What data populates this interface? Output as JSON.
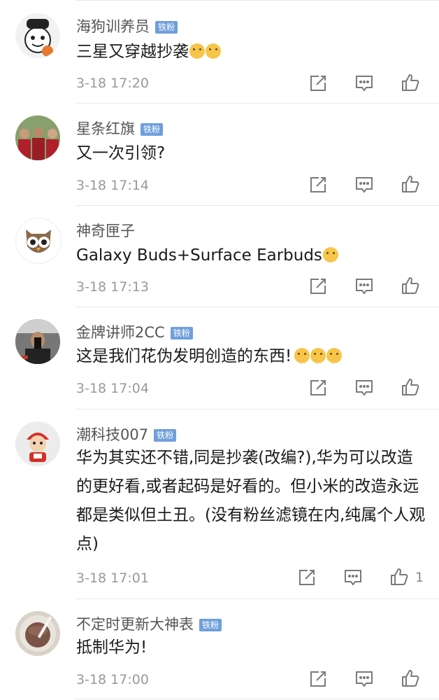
{
  "comments": [
    {
      "username": "海狗训养员",
      "badge": "铁粉",
      "text": "三星又穿越抄袭",
      "emojis": [
        "#f6c54a",
        "#f6c54a"
      ],
      "time": "3-18 17:20",
      "likes": ""
    },
    {
      "username": "星条红旗",
      "badge": "铁粉",
      "text": "又一次引领?",
      "emojis": [],
      "time": "3-18 17:14",
      "likes": ""
    },
    {
      "username": "神奇匣子",
      "badge": "",
      "text": "Galaxy Buds+Surface Earbuds",
      "emojis": [
        "#f6c54a"
      ],
      "time": "3-18 17:13",
      "likes": ""
    },
    {
      "username": "金牌讲师2CC",
      "badge": "铁粉",
      "text": "这是我们花伪发明创造的东西!",
      "emojis": [
        "#f6c54a",
        "#f6c54a",
        "#f6c54a"
      ],
      "time": "3-18 17:04",
      "likes": ""
    },
    {
      "username": "潮科技007",
      "badge": "铁粉",
      "text": "华为其实还不错,同是抄袭(改编?),华为可以改造的更好看,或者起码是好看的。但小米的改造永远都是类似但土丑。(没有粉丝滤镜在内,纯属个人观点)",
      "emojis": [],
      "time": "3-18 17:01",
      "likes": "1"
    },
    {
      "username": "不定时更新大神表",
      "badge": "铁粉",
      "text": "抵制华为!",
      "emojis": [],
      "time": "3-18 17:00",
      "likes": ""
    }
  ],
  "icons": {
    "share": "share-icon",
    "reply": "comment-icon",
    "like": "thumbs-up-icon"
  },
  "colors": {
    "badge": "#6f9fdb",
    "separator": "#e8e8e8",
    "icon": "#7a7a7a",
    "time": "#999999"
  }
}
